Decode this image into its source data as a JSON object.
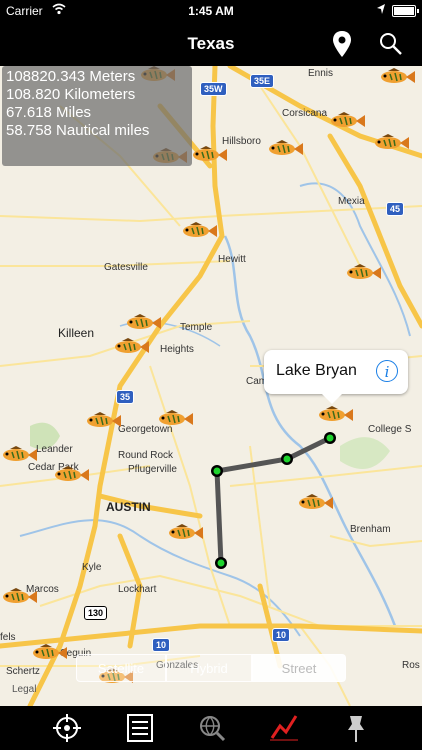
{
  "status": {
    "carrier": "Carrier",
    "time": "1:45 AM",
    "battery_level": 1.0
  },
  "nav": {
    "title": "Texas",
    "pin_icon": "map-pin-icon",
    "search_icon": "search-icon"
  },
  "distance": {
    "meters": "108820.343 Meters",
    "kilometers": "108.820 Kilometers",
    "miles": "67.618 Miles",
    "nautical": "58.758 Nautical miles"
  },
  "callout": {
    "name": "Lake Bryan",
    "info_icon": "info-icon"
  },
  "map_labels": {
    "ennis": "Ennis",
    "corsicana": "Corsicana",
    "hillsboro": "Hillsboro",
    "mexia": "Mexia",
    "gatesville": "Gatesville",
    "hewitt": "Hewitt",
    "killeen": "Killeen",
    "temple": "Temple",
    "heights": "Heights",
    "cameron": "Cam",
    "college": "College S",
    "leander": "Leander",
    "georgetown": "Georgetown",
    "round_rock": "Round Rock",
    "cedar_park": "Cedar Park",
    "pflugerville": "Pflugerville",
    "austin": "AUSTIN",
    "brenham": "Brenham",
    "kyle": "Kyle",
    "lockhart": "Lockhart",
    "marcos": "Marcos",
    "seguin": "Seguin",
    "gonzales": "Gonzales",
    "schertz": "Schertz",
    "fels": "fels",
    "ros": "Ros",
    "i35w": "35W",
    "i35e": "35E",
    "i45": "45",
    "i35": "35",
    "i10a": "10",
    "i10b": "10",
    "r130": "130"
  },
  "segments": {
    "satellite": "Satellite",
    "hybrid": "Hybrid",
    "street": "Street"
  },
  "legal": "Legal",
  "tabs": [
    "locate-icon",
    "list-icon",
    "globe-search-icon",
    "measure-icon",
    "pushpin-icon"
  ],
  "colors": {
    "fish": "#f0a030",
    "route": "#555555",
    "highway": "#f7c548",
    "road": "#fbe59a",
    "water": "#9fc4e8",
    "accent": "#1a7fe6"
  }
}
